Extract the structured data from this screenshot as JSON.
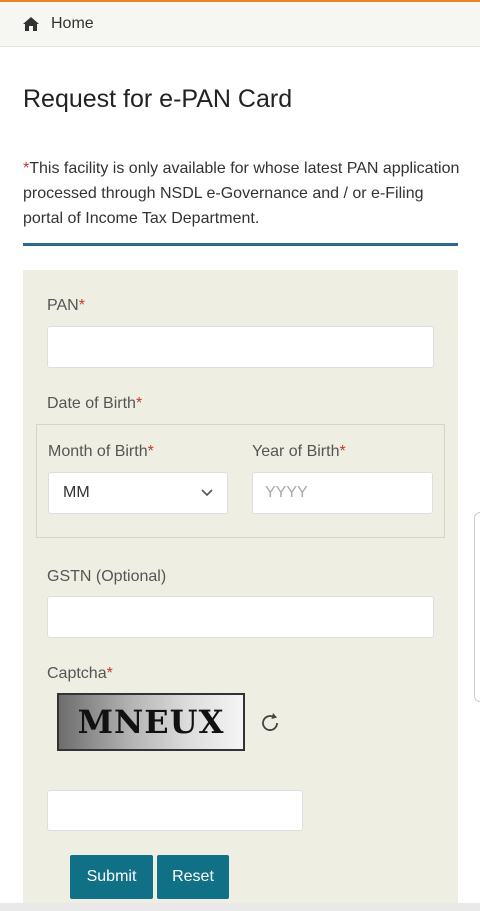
{
  "breadcrumb": {
    "home_label": "Home",
    "icon": "home-icon"
  },
  "page": {
    "title": "Request for e-PAN Card"
  },
  "notice": {
    "asterisk": "*",
    "text": "This facility is only available for whose latest PAN application processed through NSDL e-Governance and / or e-Filing portal of Income Tax Department."
  },
  "form": {
    "pan": {
      "label": "PAN",
      "required": "*",
      "value": "",
      "placeholder": ""
    },
    "dob": {
      "label": "Date of Birth",
      "required": "*",
      "month": {
        "label": "Month of Birth",
        "required": "*",
        "selected": "MM"
      },
      "year": {
        "label": "Year of Birth",
        "required": "*",
        "value": "",
        "placeholder": "YYYY"
      }
    },
    "gstn": {
      "label": "GSTN (Optional)",
      "value": "",
      "placeholder": ""
    },
    "captcha": {
      "label": "Captcha",
      "required": "*",
      "image_text": "MNEUX",
      "value": "",
      "placeholder": ""
    },
    "buttons": {
      "submit": "Submit",
      "reset": "Reset"
    }
  },
  "colors": {
    "accent_top": "#e8862a",
    "divider": "#2a6a8f",
    "panel_bg": "#efeee2",
    "button_bg": "#0f7086",
    "required": "#c0392b"
  }
}
